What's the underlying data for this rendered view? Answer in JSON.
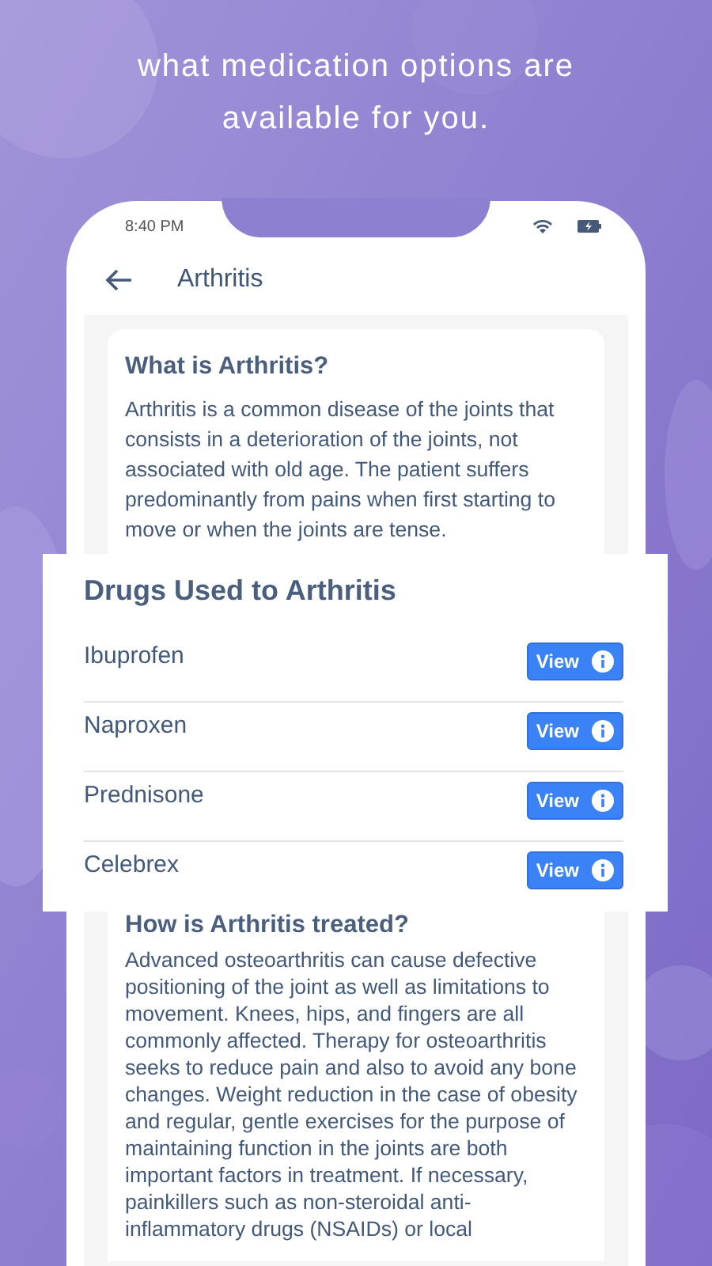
{
  "headline": "what medication options are available for you.",
  "status_bar": {
    "time": "8:40 PM"
  },
  "app_bar": {
    "title": "Arthritis"
  },
  "intro": {
    "title": "What is Arthritis?",
    "text": "Arthritis is a common disease of the joints that consists in a deterioration of the joints, not associated with old age. The patient suffers predominantly from pains when first starting to move or when the joints are tense."
  },
  "drugs": {
    "title": "Drugs Used to Arthritis",
    "items": [
      {
        "name": "Ibuprofen",
        "button": "View"
      },
      {
        "name": "Naproxen",
        "button": "View"
      },
      {
        "name": "Prednisone",
        "button": "View"
      },
      {
        "name": "Celebrex",
        "button": "View"
      }
    ]
  },
  "treatment": {
    "title": "How is Arthritis treated?",
    "text": "Advanced osteoarthritis can cause defective positioning of the joint as well as limitations to movement. Knees, hips, and fingers are all commonly affected. Therapy for osteoarthritis seeks to reduce pain and also to avoid any bone changes. Weight reduction in the case of obesity and regular, gentle exercises for the purpose of maintaining function in the joints are both important factors in treatment. If necessary, painkillers such as non-steroidal anti-inflammatory drugs (NSAIDs) or local"
  }
}
